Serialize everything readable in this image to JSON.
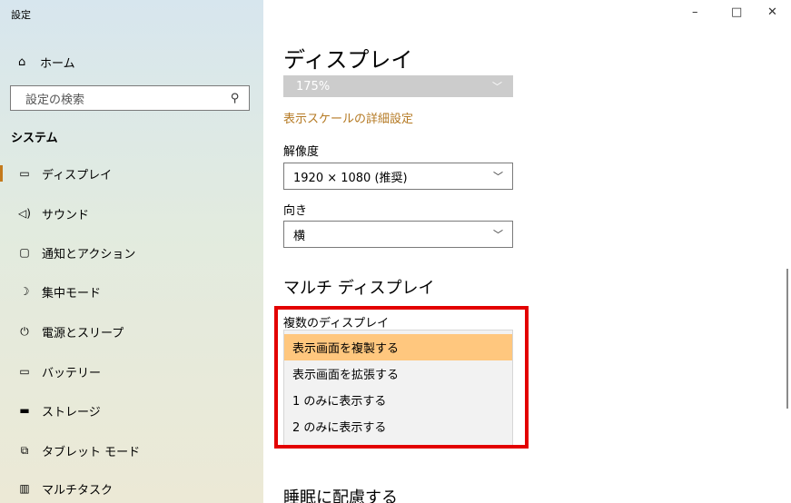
{
  "app": {
    "title": "設定",
    "window_controls": {
      "minimize": "–",
      "maximize": "□",
      "close": "✕"
    }
  },
  "sidebar": {
    "home": {
      "label": "ホーム",
      "icon": "home-icon"
    },
    "search": {
      "placeholder": "設定の検索",
      "icon": "search-icon"
    },
    "section": "システム",
    "items": [
      {
        "label": "ディスプレイ",
        "icon": "display-icon",
        "active": true
      },
      {
        "label": "サウンド",
        "icon": "speaker-icon"
      },
      {
        "label": "通知とアクション",
        "icon": "notification-icon"
      },
      {
        "label": "集中モード",
        "icon": "moon-icon"
      },
      {
        "label": "電源とスリープ",
        "icon": "power-icon"
      },
      {
        "label": "バッテリー",
        "icon": "battery-icon"
      },
      {
        "label": "ストレージ",
        "icon": "storage-icon"
      },
      {
        "label": "タブレット モード",
        "icon": "tablet-icon"
      },
      {
        "label": "マルチタスク",
        "icon": "multitask-icon"
      }
    ]
  },
  "main": {
    "title": "ディスプレイ",
    "scale": {
      "value": "175%"
    },
    "advanced_scaling_link": "表示スケールの詳細設定",
    "resolution": {
      "label": "解像度",
      "value": "1920 × 1080 (推奨)"
    },
    "orientation": {
      "label": "向き",
      "value": "横"
    },
    "multi_display": {
      "heading": "マルチ ディスプレイ",
      "label": "複数のディスプレイ",
      "options": [
        "表示画面を複製する",
        "表示画面を拡張する",
        "1 のみに表示する",
        "2 のみに表示する"
      ],
      "selected": "表示画面を複製する"
    },
    "bottom_heading": "睡眠に配慮する"
  },
  "colors": {
    "accent": "#c47a1c",
    "selected_option": "#ffc77e",
    "highlight_box": "#e30000"
  }
}
